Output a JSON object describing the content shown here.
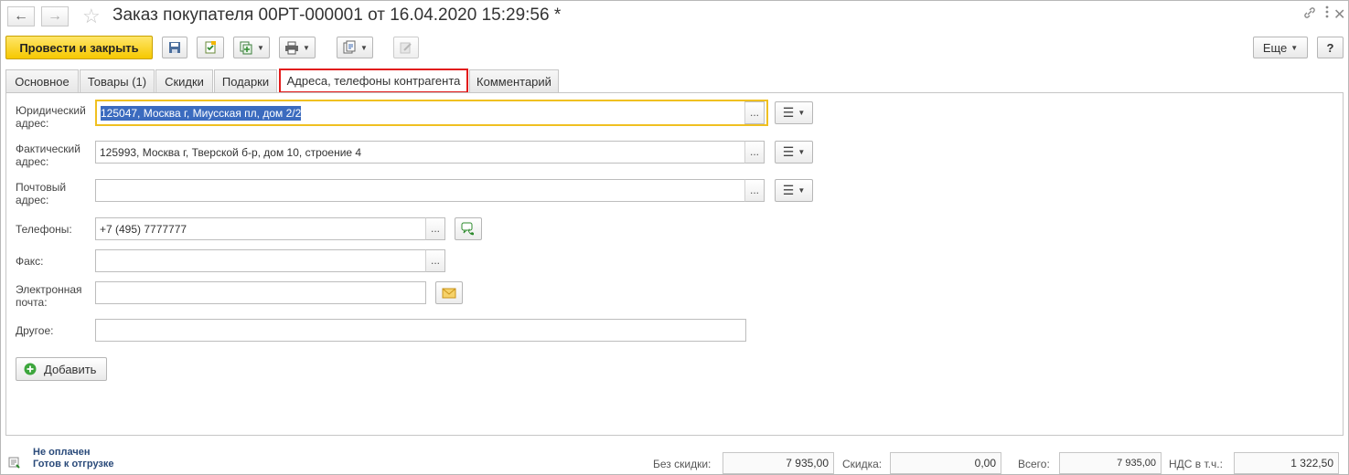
{
  "window": {
    "title": "Заказ покупателя 00РТ-000001 от 16.04.2020 15:29:56 *",
    "back_icon": "←",
    "forward_icon": "→",
    "star_icon": "☆"
  },
  "toolbar": {
    "post_close_label": "Провести и закрыть",
    "more_label": "Еще",
    "help_label": "?"
  },
  "tabs": [
    {
      "label": "Основное"
    },
    {
      "label": "Товары (1)"
    },
    {
      "label": "Скидки"
    },
    {
      "label": "Подарки"
    },
    {
      "label": "Адреса, телефоны контрагента"
    },
    {
      "label": "Комментарий"
    }
  ],
  "form": {
    "legal_address_label": "Юридический адрес:",
    "legal_address_value": "125047, Москва г, Миусская пл, дом 2/2",
    "actual_address_label": "Фактический адрес:",
    "actual_address_value": "125993, Москва г, Тверской б-р, дом 10, строение 4",
    "postal_address_label": "Почтовый адрес:",
    "postal_address_value": "",
    "phones_label": "Телефоны:",
    "phones_value": "+7 (495) 7777777",
    "fax_label": "Факс:",
    "fax_value": "",
    "email_label": "Электронная почта:",
    "email_value": "",
    "other_label": "Другое:",
    "other_value": "",
    "dots_label": "...",
    "add_label": "Добавить"
  },
  "footer": {
    "status_paid": "Не оплачен",
    "status_shipping": "Готов к отгрузке",
    "no_discount_label": "Без скидки:",
    "no_discount_value": "7 935,00",
    "discount_label": "Скидка:",
    "discount_value": "0,00",
    "total_label": "Всего:",
    "total_value": "7 935,00",
    "vat_label": "НДС в т.ч.:",
    "vat_value": "1 322,50"
  },
  "colors": {
    "primary_button": "#f6c800",
    "active_tab_border": "#e21b1b",
    "focus_border": "#f0c020",
    "selection": "#3b6bbf"
  }
}
